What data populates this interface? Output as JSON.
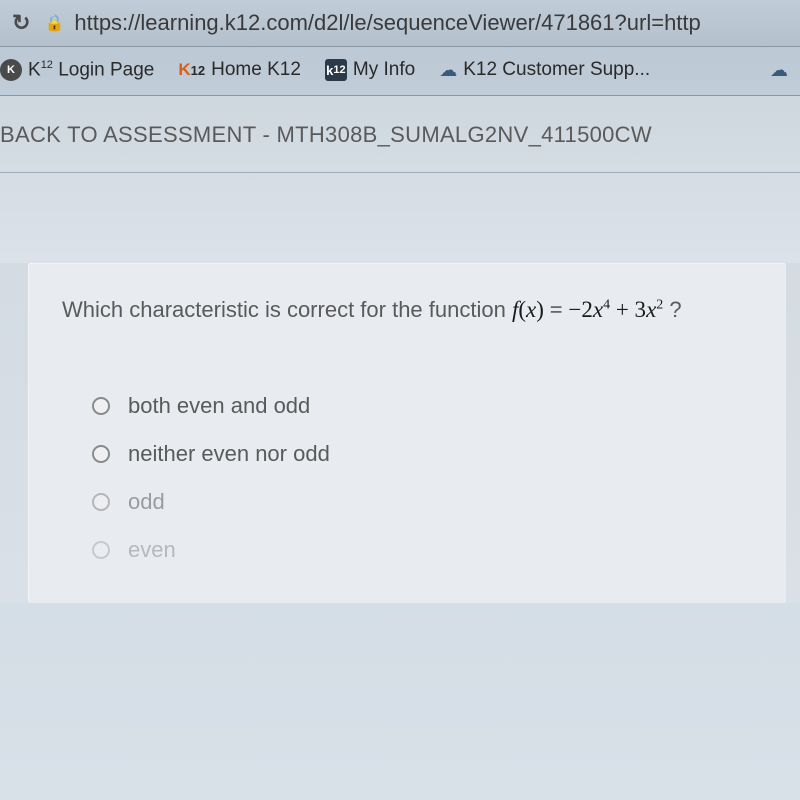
{
  "browser": {
    "url": "https://learning.k12.com/d2l/le/sequenceViewer/471861?url=http"
  },
  "bookmarks": [
    {
      "label": "K¹² Login Page",
      "icon": "k12-round"
    },
    {
      "label": "Home K12",
      "icon": "k12-orange",
      "prefix": "K12"
    },
    {
      "label": "My Info",
      "icon": "k12-dark",
      "iconText": "k¹²"
    },
    {
      "label": "K12 Customer Supp...",
      "icon": "cloud"
    }
  ],
  "breadcrumb": "BACK TO ASSESSMENT - MTH308B_SUMALG2NV_411500CW",
  "question": {
    "prompt_prefix": "Which characteristic is correct for the function ",
    "function_expr": "f(x) = −2x⁴ + 3x²",
    "prompt_suffix": " ?"
  },
  "options": [
    {
      "label": "both even and odd"
    },
    {
      "label": "neither even nor odd"
    },
    {
      "label": "odd"
    },
    {
      "label": "even"
    }
  ]
}
